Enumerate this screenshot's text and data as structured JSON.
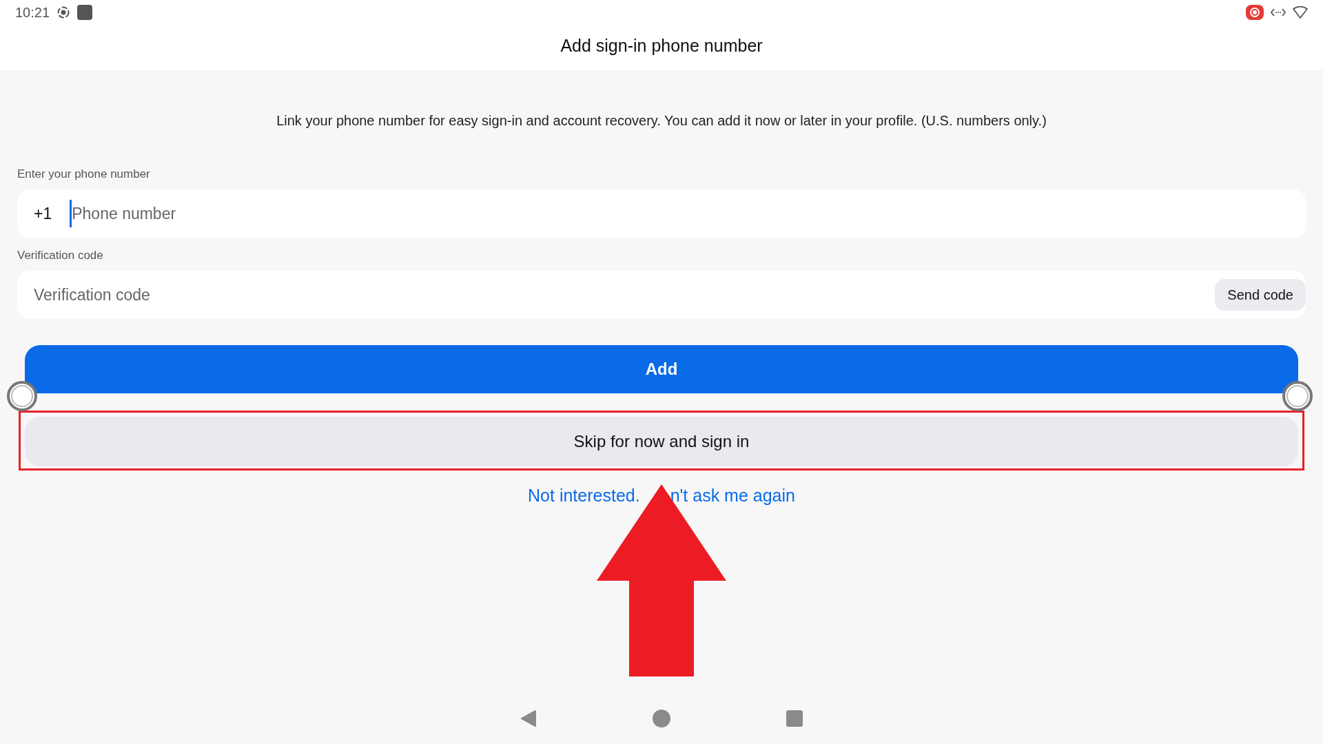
{
  "status_bar": {
    "time": "10:21"
  },
  "header": {
    "title": "Add sign-in phone number"
  },
  "description": "Link your phone number for easy sign-in and account recovery. You can add it now or later in your profile. (U.S. numbers only.)",
  "phone": {
    "label": "Enter your phone number",
    "country_code": "+1",
    "placeholder": "Phone number"
  },
  "verification": {
    "label": "Verification code",
    "placeholder": "Verification code",
    "button": "Send code"
  },
  "primary_button": "Add",
  "secondary_button": "Skip for now and sign in",
  "link_parts": [
    "Not interested.",
    "n't ask me again"
  ]
}
